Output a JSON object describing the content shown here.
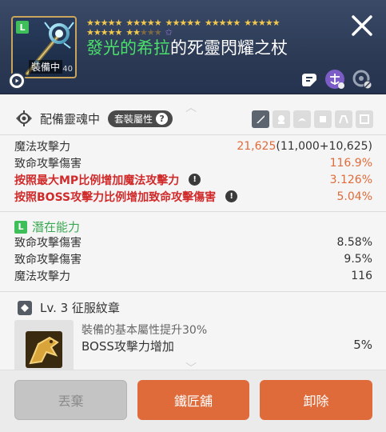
{
  "header": {
    "item_badge": "L",
    "equipped_label": "裝備中",
    "item_level": "40",
    "name_highlight": "發光的希拉",
    "name_rest": "的死靈閃耀之杖",
    "stars_row1": [
      5,
      5,
      5,
      5,
      5
    ],
    "stars_row2_gold": 2,
    "stars_row2_dim": 3,
    "icons": [
      "scroll-icon",
      "arcane-symbol-icon",
      "disabled-settings-icon"
    ]
  },
  "soul": {
    "label": "配備靈魂中",
    "set_label": "套裝屬性",
    "help": "?"
  },
  "stats": [
    {
      "label": "魔法攻擊力",
      "value": "21,625",
      "detail": "(11,000+10,625)",
      "red": false,
      "warn": false
    },
    {
      "label": "致命攻擊傷害",
      "value": "116.9%",
      "detail": "",
      "red": false,
      "warn": false
    },
    {
      "label": "按照最大MP比例增加魔法攻擊力",
      "value": "3.126%",
      "detail": "",
      "red": true,
      "warn": true
    },
    {
      "label": "按照BOSS攻擊力比例增加致命攻擊傷害",
      "value": "5.04%",
      "detail": "",
      "red": true,
      "warn": true
    }
  ],
  "potential": {
    "badge": "L",
    "title": "潛在能力",
    "lines": [
      {
        "label": "致命攻擊傷害",
        "value": "8.58%"
      },
      {
        "label": "致命攻擊傷害",
        "value": "9.5%"
      },
      {
        "label": "魔法攻擊力",
        "value": "116"
      }
    ]
  },
  "emblem": {
    "title": "Lv. 3 征服紋章",
    "description": "裝備的基本屬性提升30%",
    "stat_label": "BOSS攻擊力增加",
    "stat_value": "5%"
  },
  "buttons": {
    "discard": "丟棄",
    "blacksmith": "鐵匠舖",
    "remove": "卸除"
  },
  "colors": {
    "accent_orange": "#e06b3a",
    "name_green": "#4be06b",
    "stat_red": "#d12a2a",
    "star_gold": "#f2c94c"
  }
}
